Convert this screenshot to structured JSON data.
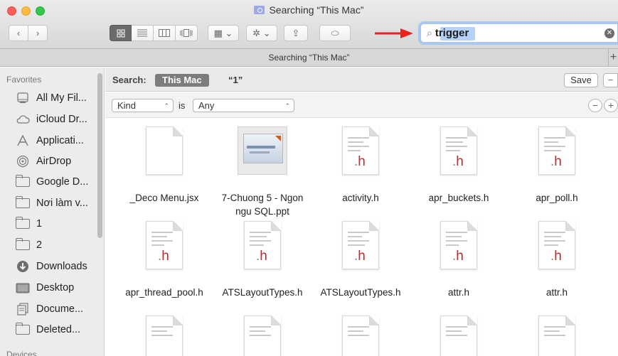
{
  "window": {
    "title": "Searching “This Mac”",
    "tab_label": "Searching “This Mac”",
    "tab_add": "+"
  },
  "toolbar": {
    "back": "‹",
    "forward": "›",
    "view_modes": [
      "icon-view",
      "list-view",
      "column-view",
      "cover-flow-view"
    ],
    "arrange_label": "▦ ⌄",
    "action_label": "✲ ⌄",
    "share_label": "⇪",
    "tags_label": "⬭"
  },
  "search": {
    "value": "trigger",
    "clear": "✕"
  },
  "sidebar": {
    "favorites_heading": "Favorites",
    "devices_heading": "Devices",
    "items": [
      {
        "label": "All My Fil...",
        "icon": "all-my-files-icon"
      },
      {
        "label": "iCloud Dr...",
        "icon": "cloud-icon"
      },
      {
        "label": "Applicati...",
        "icon": "applications-icon"
      },
      {
        "label": "AirDrop",
        "icon": "airdrop-icon"
      },
      {
        "label": "Google D...",
        "icon": "folder-icon"
      },
      {
        "label": "Nơi làm v...",
        "icon": "folder-icon"
      },
      {
        "label": "1",
        "icon": "folder-icon"
      },
      {
        "label": "2",
        "icon": "folder-icon"
      },
      {
        "label": "Downloads",
        "icon": "downloads-icon"
      },
      {
        "label": "Desktop",
        "icon": "desktop-icon"
      },
      {
        "label": "Docume...",
        "icon": "documents-icon"
      },
      {
        "label": "Deleted...",
        "icon": "folder-icon"
      }
    ]
  },
  "scope": {
    "label": "Search:",
    "active": "This Mac",
    "other": "“1”",
    "save": "Save",
    "minus": "−"
  },
  "criteria": {
    "kind": "Kind",
    "is": "is",
    "value": "Any",
    "minus": "−",
    "plus": "+"
  },
  "files": [
    {
      "name": "_Deco Menu.jsx",
      "type": "blank",
      "ext": ""
    },
    {
      "name": "7-Chuong 5 - Ngon ngu SQL.ppt",
      "type": "ppt",
      "ext": ""
    },
    {
      "name": "activity.h",
      "type": "h",
      "ext": "h"
    },
    {
      "name": "apr_buckets.h",
      "type": "h",
      "ext": "h"
    },
    {
      "name": "apr_poll.h",
      "type": "h",
      "ext": "h"
    },
    {
      "name": "apr_thread_pool.h",
      "type": "h",
      "ext": "h"
    },
    {
      "name": "ATSLayoutTypes.h",
      "type": "h",
      "ext": "h"
    },
    {
      "name": "ATSLayoutTypes.h",
      "type": "h",
      "ext": "h"
    },
    {
      "name": "attr.h",
      "type": "h",
      "ext": "h"
    },
    {
      "name": "attr.h",
      "type": "h",
      "ext": "h"
    }
  ],
  "colors": {
    "arrow": "#e8241c",
    "search_focus": "#a8c8f0",
    "h_ext": "#c0282a"
  }
}
